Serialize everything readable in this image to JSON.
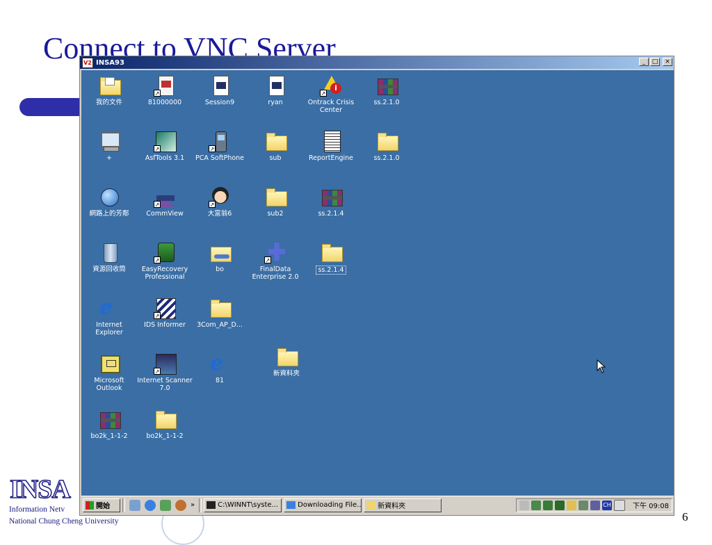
{
  "slide": {
    "title": "Connect to VNC Server",
    "logo": "INSA",
    "info_line1": "Information Netv",
    "info_line2": "National Chung Cheng University",
    "page_number": "6"
  },
  "window": {
    "title": "INSA93",
    "app_icon": "V2",
    "buttons": {
      "minimize": "_",
      "maximize": "□",
      "close": "×"
    }
  },
  "desktop": {
    "icons": [
      {
        "label": "我的文件",
        "type": "folder-docs"
      },
      {
        "label": "81000000",
        "type": "app-81"
      },
      {
        "label": "Session9",
        "type": "doc"
      },
      {
        "label": "ryan",
        "type": "doc"
      },
      {
        "label": "Ontrack Crisis Center",
        "type": "crisis"
      },
      {
        "label": "ss.2.1.0",
        "type": "winrar"
      },
      {
        "label": "+",
        "type": "computer"
      },
      {
        "label": "AsfTools 3.1",
        "type": "asf"
      },
      {
        "label": "PCA SoftPhone",
        "type": "phone"
      },
      {
        "label": "sub",
        "type": "folder"
      },
      {
        "label": "ReportEngine",
        "type": "report"
      },
      {
        "label": "ss.2.1.0",
        "type": "folder"
      },
      {
        "label": "網路上的芳鄰",
        "type": "globe"
      },
      {
        "label": "CommView",
        "type": "commview"
      },
      {
        "label": "大富翁6",
        "type": "game"
      },
      {
        "label": "sub2",
        "type": "folder"
      },
      {
        "label": "ss.2.1.4",
        "type": "winrar"
      },
      {
        "label": "資源回收筒",
        "type": "recycle"
      },
      {
        "label": "EasyRecovery Professional",
        "type": "easyrec"
      },
      {
        "label": "bo",
        "type": "bo"
      },
      {
        "label": "FinalData Enterprise 2.0",
        "type": "finaldata"
      },
      {
        "label": "ss.2.1.4",
        "type": "folder-selected"
      },
      {
        "label": "Internet Explorer",
        "type": "ie"
      },
      {
        "label": "IDS Informer",
        "type": "ids"
      },
      {
        "label": "3Com_AP_D...",
        "type": "folder"
      },
      {
        "label": "Microsoft Outlook",
        "type": "outlook"
      },
      {
        "label": "Internet Scanner 7.0",
        "type": "scanner"
      },
      {
        "label": "81",
        "type": "ie"
      },
      {
        "label": "新資料夾",
        "type": "folder"
      },
      {
        "label": "bo2k_1-1-2",
        "type": "winrar"
      },
      {
        "label": "bo2k_1-1-2",
        "type": "folder"
      }
    ]
  },
  "taskbar": {
    "start_label": "開始",
    "chevron": "»",
    "tasks": [
      {
        "label": "C:\\WINNT\\syste...",
        "icon": "cmd-icon"
      },
      {
        "label": "Downloading File...",
        "icon": "ie-icon"
      },
      {
        "label": "新資料夾",
        "icon": "folder-icon"
      }
    ],
    "tray_lang": "CH",
    "clock": "下午 09:08"
  },
  "colors": {
    "desktop": "#3a6ea5",
    "titlebar": "#0a246a",
    "slide_title": "#1a1a99"
  }
}
